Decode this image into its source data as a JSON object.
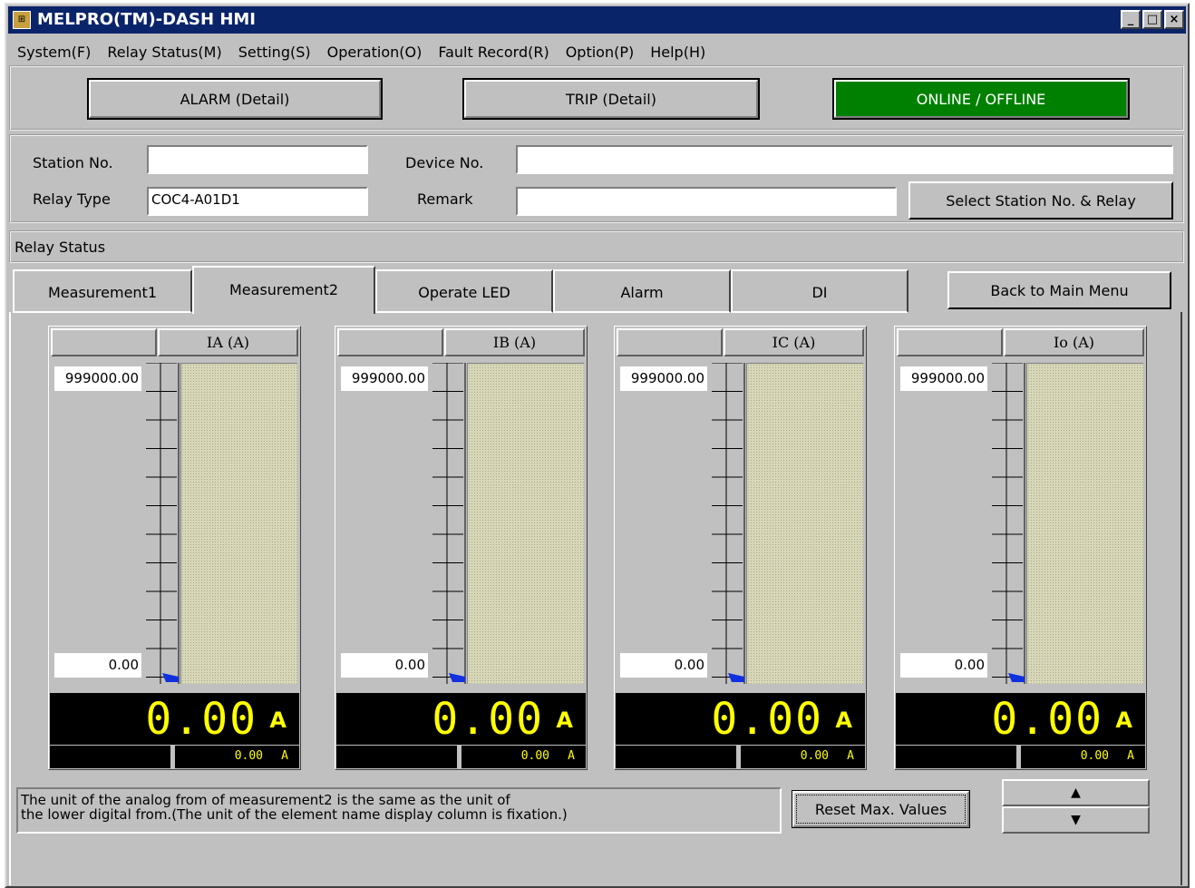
{
  "window": {
    "title": "MELPRO(TM)-DASH HMI",
    "controls": [
      "_",
      "□",
      "×"
    ]
  },
  "menu": [
    "System(F)",
    "Relay Status(M)",
    "Setting(S)",
    "Operation(O)",
    "Fault Record(R)",
    "Option(P)",
    "Help(H)"
  ],
  "status_buttons": {
    "alarm": "ALARM (Detail)",
    "trip": "TRIP (Detail)",
    "online": "ONLINE / OFFLINE",
    "online_color": "#008000"
  },
  "station": {
    "station_no_label": "Station No.",
    "station_no_value": "",
    "device_no_label": "Device No.",
    "device_no_value": "",
    "relay_type_label": "Relay Type",
    "relay_type_value": "COC4-A01D1",
    "remark_label": "Remark",
    "remark_value": "",
    "select_button": "Select Station No. & Relay"
  },
  "relay_status_label": "Relay Status",
  "tabs": [
    "Measurement1",
    "Measurement2",
    "Operate LED",
    "Alarm",
    "DI"
  ],
  "active_tab": "Measurement2",
  "back_button": "Back to Main Menu",
  "meters": [
    {
      "name": "IA (A)",
      "max": "999000.00",
      "min": "0.00",
      "value": "0.00",
      "unit": "A",
      "sub_value": "0.00",
      "sub_unit": "A"
    },
    {
      "name": "IB (A)",
      "max": "999000.00",
      "min": "0.00",
      "value": "0.00",
      "unit": "A",
      "sub_value": "0.00",
      "sub_unit": "A"
    },
    {
      "name": "IC (A)",
      "max": "999000.00",
      "min": "0.00",
      "value": "0.00",
      "unit": "A",
      "sub_value": "0.00",
      "sub_unit": "A"
    },
    {
      "name": "Io (A)",
      "max": "999000.00",
      "min": "0.00",
      "value": "0.00",
      "unit": "A",
      "sub_value": "0.00",
      "sub_unit": "A"
    }
  ],
  "note_line1": "The unit of the analog from of measurement2 is the same as the unit of",
  "note_line2": "the lower digital from.(The unit of the element name display column is fixation.)",
  "reset_button": "Reset Max. Values",
  "up_arrow": "▲",
  "down_arrow": "▼",
  "digital_color": "#ffff00"
}
